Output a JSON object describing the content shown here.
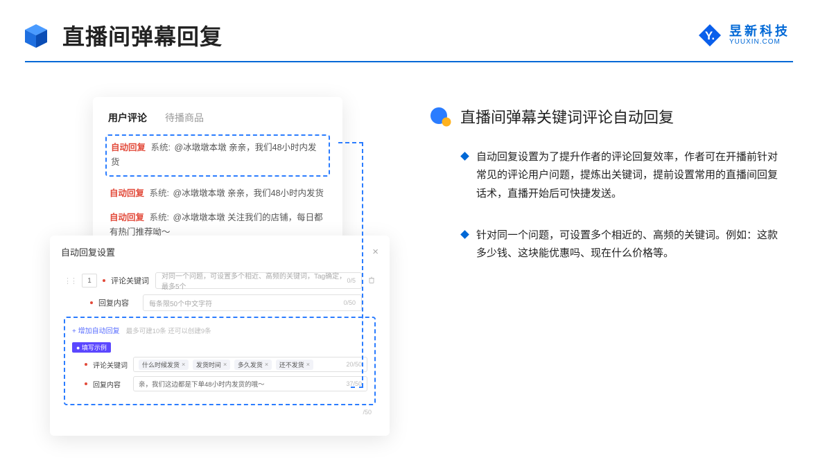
{
  "header": {
    "title": "直播间弹幕回复",
    "logo_cn": "昱新科技",
    "logo_en": "YUUXIN.COM"
  },
  "comments_card": {
    "tab_active": "用户评论",
    "tab_inactive": "待播商品",
    "line1": {
      "tag": "自动回复",
      "sys": "系统:",
      "text": "@冰墩墩本墩 亲亲，我们48小时内发货"
    },
    "line2": {
      "tag": "自动回复",
      "sys": "系统:",
      "text": "@冰墩墩本墩 亲亲，我们48小时内发货"
    },
    "line3": {
      "tag": "自动回复",
      "sys": "系统:",
      "text": "@冰墩墩本墩 关注我们的店铺，每日都有热门推荐呦～"
    }
  },
  "settings_card": {
    "title": "自动回复设置",
    "num": "1",
    "row1_label": "评论关键词",
    "row1_placeholder": "对同一个问题，可设置多个相近、高频的关键词，Tag确定，最多5个",
    "row1_counter": "0/5",
    "row2_label": "回复内容",
    "row2_placeholder": "每条限50个中文字符",
    "row2_counter": "0/50",
    "add_text": "+ 增加自动回复",
    "add_help": "最多可建10条 还可以创建9条",
    "badge": "● 填写示例",
    "ex1_label": "评论关键词",
    "ex1_tags": [
      "什么时候发货",
      "发货时间",
      "多久发货",
      "还不发货"
    ],
    "ex1_counter": "20/50",
    "ex2_label": "回复内容",
    "ex2_text": "亲，我们这边都是下单48小时内发货的哦～",
    "ex2_counter": "37/50",
    "outer_counter": "/50"
  },
  "right": {
    "title": "直播间弹幕关键词评论自动回复",
    "bullet1": "自动回复设置为了提升作者的评论回复效率，作者可在开播前针对常见的评论用户问题，提炼出关键词，提前设置常用的直播间回复话术，直播开始后可快捷发送。",
    "bullet2": "针对同一个问题，可设置多个相近的、高频的关键词。例如：这款多少钱、这块能优惠吗、现在什么价格等。"
  }
}
